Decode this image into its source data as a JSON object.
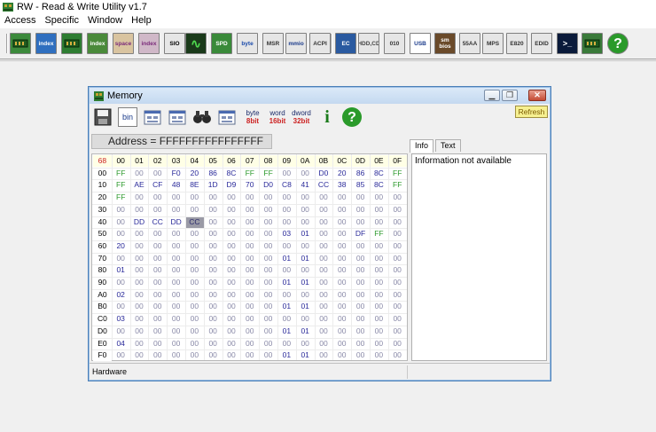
{
  "app": {
    "title": "RW - Read & Write Utility v1.7"
  },
  "menu": [
    "Access",
    "Specific",
    "Window",
    "Help"
  ],
  "toolbar": [
    {
      "icon": "pci-icon",
      "bg": "#3c8a3c",
      "fg": "#ffffff",
      "text": ""
    },
    {
      "icon": "index-icon",
      "bg": "#2f6fbf",
      "fg": "#ffffff",
      "text": "index"
    },
    {
      "icon": "memory-module-icon",
      "bg": "#2e7d32",
      "fg": "#ffffff",
      "text": ""
    },
    {
      "icon": "index-io-icon",
      "bg": "#4a8a3a",
      "fg": "#ffffff",
      "text": "index"
    },
    {
      "icon": "index-space-icon",
      "bg": "#d9c4a0",
      "fg": "#7a2a7a",
      "text": "space"
    },
    {
      "icon": "index-x-icon",
      "bg": "#d0b8c8",
      "fg": "#7a2a7a",
      "text": "index"
    },
    {
      "icon": "sio-icon",
      "bg": "#e6e6e6",
      "fg": "#000000",
      "text": "SIO"
    },
    {
      "icon": "oscilloscope-icon",
      "bg": "#1a3a1a",
      "fg": "#4fdc4f",
      "text": "∿"
    },
    {
      "icon": "spd-icon",
      "bg": "#3a8a3a",
      "fg": "#ffffff",
      "text": "SPD"
    },
    {
      "icon": "byte-word-icon",
      "bg": "#e6e6e6",
      "fg": "#1a4aaa",
      "text": "byte"
    },
    {
      "icon": "msr-icon",
      "bg": "#e6e6e6",
      "fg": "#333333",
      "text": "MSR"
    },
    {
      "icon": "mmio-icon",
      "bg": "#e6e6e6",
      "fg": "#1a3a8a",
      "text": "mmio"
    },
    {
      "icon": "acpi-icon",
      "bg": "#e6e6e6",
      "fg": "#333333",
      "text": "ACPI"
    },
    {
      "icon": "ec-icon",
      "bg": "#2a5aa0",
      "fg": "#ffffff",
      "text": "EC"
    },
    {
      "icon": "hdd-cd-icon",
      "bg": "#e6e6e6",
      "fg": "#444444",
      "text": "HDD,CD"
    },
    {
      "icon": "disk-010-icon",
      "bg": "#e6e6e6",
      "fg": "#333333",
      "text": "010"
    },
    {
      "icon": "usb-icon",
      "bg": "#ffffff",
      "fg": "#1a3a8a",
      "text": "USB"
    },
    {
      "icon": "smbios-icon",
      "bg": "#6a4a2a",
      "fg": "#ffffff",
      "text": "sm bios"
    },
    {
      "icon": "55aa-icon",
      "bg": "#e6e6e6",
      "fg": "#333333",
      "text": "55AA"
    },
    {
      "icon": "mps-icon",
      "bg": "#e6e6e6",
      "fg": "#333333",
      "text": "MPS"
    },
    {
      "icon": "e820-icon",
      "bg": "#e6e6e6",
      "fg": "#333333",
      "text": "E820"
    },
    {
      "icon": "edid-icon",
      "bg": "#e6e6e6",
      "fg": "#333333",
      "text": "EDID"
    },
    {
      "icon": "command-prompt-icon",
      "bg": "#0a1a3a",
      "fg": "#ffffff",
      "text": ">_"
    },
    {
      "icon": "tools-icon",
      "bg": "#3a7a3a",
      "fg": "#ffffff",
      "text": ""
    },
    {
      "icon": "help-icon",
      "bg": "#2a9a2a",
      "fg": "#ffffff",
      "text": "?"
    }
  ],
  "memory_window": {
    "title": "Memory",
    "toolbar": [
      {
        "icon": "save-icon",
        "text": ""
      },
      {
        "icon": "bin-file-icon",
        "text": "bin"
      },
      {
        "icon": "write-file-icon",
        "text": ""
      },
      {
        "icon": "read-file-icon",
        "text": ""
      },
      {
        "icon": "binoculars-icon",
        "text": ""
      },
      {
        "icon": "window-layout-icon",
        "text": ""
      },
      {
        "icon": "byte-8bit-icon",
        "text": "byte",
        "sub": "8bit"
      },
      {
        "icon": "word-16bit-icon",
        "text": "word",
        "sub": "16bit"
      },
      {
        "icon": "dword-32bit-icon",
        "text": "dword",
        "sub": "32bit"
      },
      {
        "icon": "info-icon",
        "text": "i"
      },
      {
        "icon": "help-icon",
        "text": "?"
      }
    ],
    "refresh_label": "Refresh",
    "address": "Address = FFFFFFFFFFFFFFFF",
    "corner": "68",
    "col_headers": [
      "00",
      "01",
      "02",
      "03",
      "04",
      "05",
      "06",
      "07",
      "08",
      "09",
      "0A",
      "0B",
      "0C",
      "0D",
      "0E",
      "0F"
    ],
    "row_headers": [
      "00",
      "10",
      "20",
      "30",
      "40",
      "50",
      "60",
      "70",
      "80",
      "90",
      "A0",
      "B0",
      "C0",
      "D0",
      "E0",
      "F0"
    ],
    "rows": [
      [
        "FF",
        "00",
        "00",
        "F0",
        "20",
        "86",
        "8C",
        "FF",
        "FF",
        "00",
        "00",
        "D0",
        "20",
        "86",
        "8C",
        "FF"
      ],
      [
        "FF",
        "AE",
        "CF",
        "48",
        "8E",
        "1D",
        "D9",
        "70",
        "D0",
        "C8",
        "41",
        "CC",
        "38",
        "85",
        "8C",
        "FF"
      ],
      [
        "FF",
        "00",
        "00",
        "00",
        "00",
        "00",
        "00",
        "00",
        "00",
        "00",
        "00",
        "00",
        "00",
        "00",
        "00",
        "00"
      ],
      [
        "00",
        "00",
        "00",
        "00",
        "00",
        "00",
        "00",
        "00",
        "00",
        "00",
        "00",
        "00",
        "00",
        "00",
        "00",
        "00"
      ],
      [
        "00",
        "DD",
        "CC",
        "DD",
        "CC",
        "00",
        "00",
        "00",
        "00",
        "00",
        "00",
        "00",
        "00",
        "00",
        "00",
        "00"
      ],
      [
        "00",
        "00",
        "00",
        "00",
        "00",
        "00",
        "00",
        "00",
        "00",
        "03",
        "01",
        "00",
        "00",
        "DF",
        "FF",
        "00"
      ],
      [
        "20",
        "00",
        "00",
        "00",
        "00",
        "00",
        "00",
        "00",
        "00",
        "00",
        "00",
        "00",
        "00",
        "00",
        "00",
        "00"
      ],
      [
        "00",
        "00",
        "00",
        "00",
        "00",
        "00",
        "00",
        "00",
        "00",
        "01",
        "01",
        "00",
        "00",
        "00",
        "00",
        "00"
      ],
      [
        "01",
        "00",
        "00",
        "00",
        "00",
        "00",
        "00",
        "00",
        "00",
        "00",
        "00",
        "00",
        "00",
        "00",
        "00",
        "00"
      ],
      [
        "00",
        "00",
        "00",
        "00",
        "00",
        "00",
        "00",
        "00",
        "00",
        "01",
        "01",
        "00",
        "00",
        "00",
        "00",
        "00"
      ],
      [
        "02",
        "00",
        "00",
        "00",
        "00",
        "00",
        "00",
        "00",
        "00",
        "00",
        "00",
        "00",
        "00",
        "00",
        "00",
        "00"
      ],
      [
        "00",
        "00",
        "00",
        "00",
        "00",
        "00",
        "00",
        "00",
        "00",
        "01",
        "01",
        "00",
        "00",
        "00",
        "00",
        "00"
      ],
      [
        "03",
        "00",
        "00",
        "00",
        "00",
        "00",
        "00",
        "00",
        "00",
        "00",
        "00",
        "00",
        "00",
        "00",
        "00",
        "00"
      ],
      [
        "00",
        "00",
        "00",
        "00",
        "00",
        "00",
        "00",
        "00",
        "00",
        "01",
        "01",
        "00",
        "00",
        "00",
        "00",
        "00"
      ],
      [
        "04",
        "00",
        "00",
        "00",
        "00",
        "00",
        "00",
        "00",
        "00",
        "00",
        "00",
        "00",
        "00",
        "00",
        "00",
        "00"
      ],
      [
        "00",
        "00",
        "00",
        "00",
        "00",
        "00",
        "00",
        "00",
        "00",
        "01",
        "01",
        "00",
        "00",
        "00",
        "00",
        "00"
      ]
    ],
    "selected_cell": {
      "row": 4,
      "col": 4
    },
    "colors": {
      "zero": "#8a8aa8",
      "ff": "#2e9a2e",
      "value": "#2a2a9a",
      "selected_bg": "#9a9aa6"
    },
    "tabs": [
      "Info",
      "Text"
    ],
    "active_tab": 0,
    "info_text": "Information not available",
    "status": "Hardware"
  }
}
